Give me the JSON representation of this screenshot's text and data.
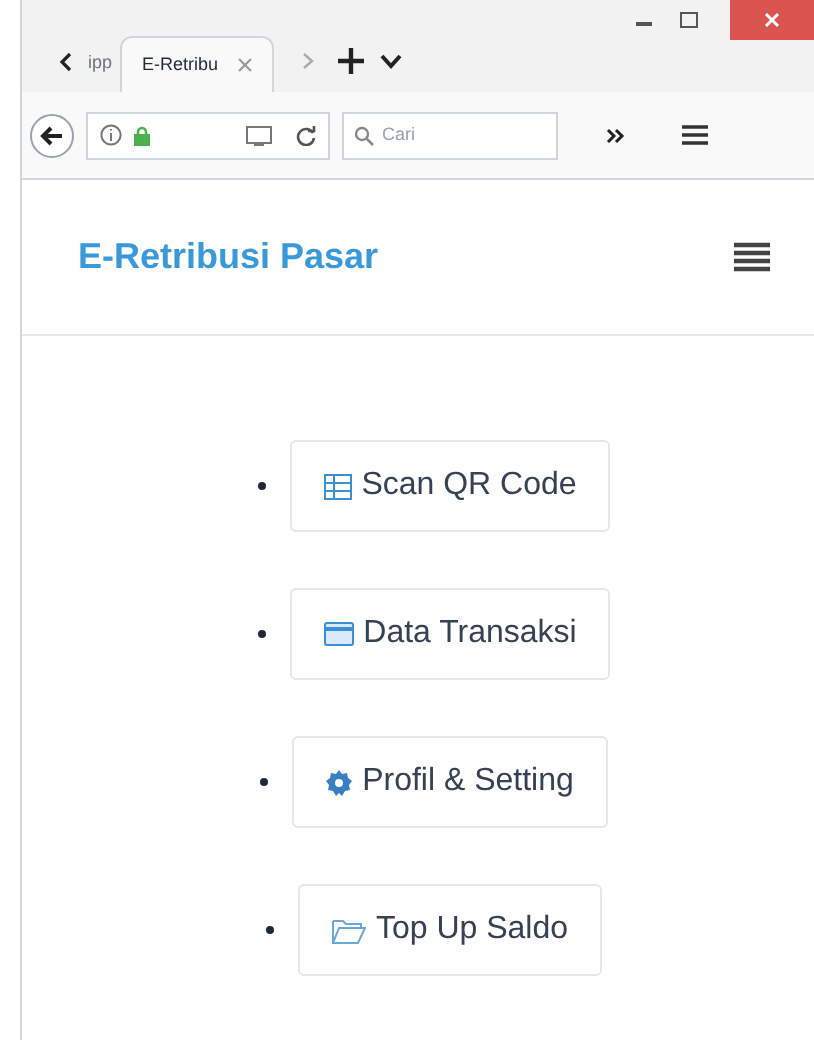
{
  "browser": {
    "tabs": [
      {
        "label": "ipp",
        "selected": false
      },
      {
        "label": "E-Retribu",
        "selected": true
      }
    ],
    "search": {
      "placeholder": "Cari"
    }
  },
  "app": {
    "title": "E-Retribusi Pasar"
  },
  "menu": [
    {
      "label": "Scan QR Code",
      "kind": "qr"
    },
    {
      "label": "Data Transaksi",
      "kind": "card"
    },
    {
      "label": "Profil & Setting",
      "kind": "gear"
    },
    {
      "label": "Top Up Saldo",
      "kind": "folder"
    }
  ]
}
